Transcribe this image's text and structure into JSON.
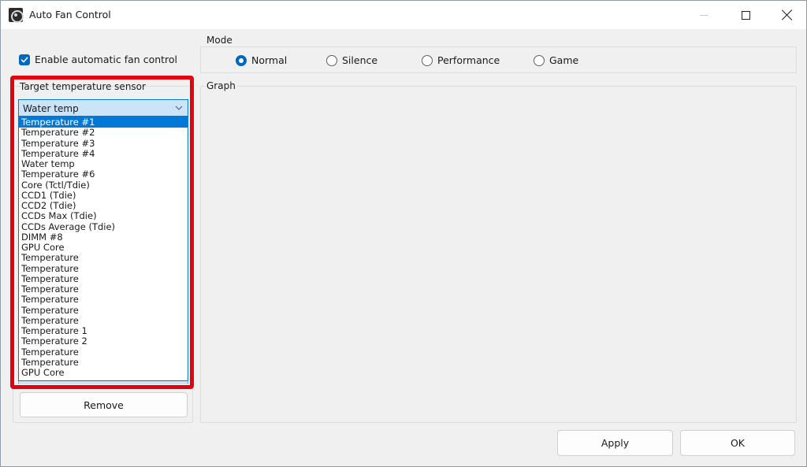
{
  "window": {
    "title": "Auto Fan Control"
  },
  "enable_auto": {
    "label": "Enable automatic fan control",
    "checked": true
  },
  "mode": {
    "title": "Mode",
    "options": [
      "Normal",
      "Silence",
      "Performance",
      "Game"
    ],
    "selected": "Normal"
  },
  "graph": {
    "title": "Graph"
  },
  "sensor": {
    "label": "Target temperature sensor",
    "current_value": "Water temp",
    "options": [
      "Temperature #1",
      "Temperature #2",
      "Temperature #3",
      "Temperature #4",
      "Water temp",
      "Temperature #6",
      "Core (Tctl/Tdie)",
      "CCD1 (Tdie)",
      "CCD2 (Tdie)",
      "CCDs Max (Tdie)",
      "CCDs Average (Tdie)",
      "DIMM #8",
      "GPU Core",
      "Temperature",
      "Temperature",
      "Temperature",
      "Temperature",
      "Temperature",
      "Temperature",
      "Temperature",
      "Temperature 1",
      "Temperature 2",
      "Temperature",
      "Temperature",
      "GPU Core"
    ],
    "highlighted_index": 0
  },
  "buttons": {
    "remove": "Remove",
    "apply": "Apply",
    "ok": "OK"
  },
  "colors": {
    "accent": "#0067c0",
    "highlight_border": "#e3000f",
    "selection": "#0078d7"
  }
}
